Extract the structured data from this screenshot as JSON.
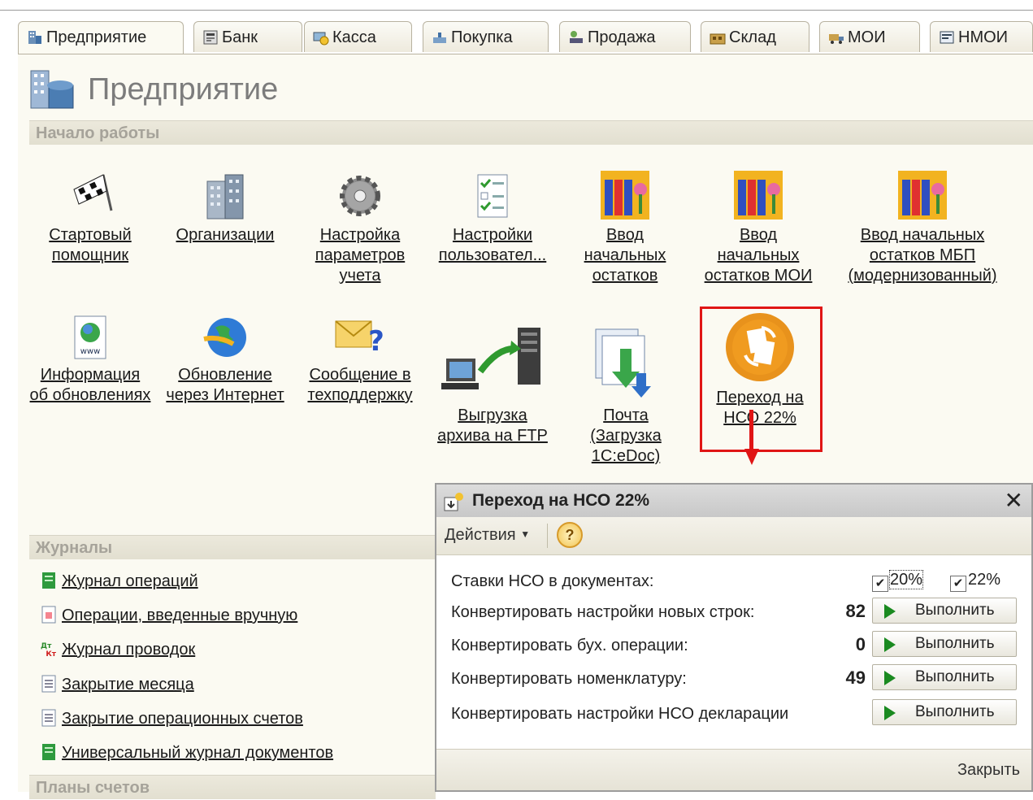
{
  "tabs": [
    {
      "label": "Предприятие",
      "icon": "enterprise-icon",
      "active": true
    },
    {
      "label": "Банк",
      "icon": "bank-icon"
    },
    {
      "label": "Касса",
      "icon": "cash-icon"
    },
    {
      "label": "Покупка",
      "icon": "purchase-icon"
    },
    {
      "label": "Продажа",
      "icon": "sale-icon"
    },
    {
      "label": "Склад",
      "icon": "warehouse-icon"
    },
    {
      "label": "МОИ",
      "icon": "truck-icon"
    },
    {
      "label": "НМОИ",
      "icon": "nmoi-icon"
    }
  ],
  "page": {
    "title": "Предприятие"
  },
  "sections": {
    "start": "Начало работы",
    "journals": "Журналы",
    "charts": "Планы счетов"
  },
  "tiles": [
    {
      "label": "Стартовый помощник",
      "icon": "checkered-flag-icon"
    },
    {
      "label": "Организации",
      "icon": "building-icon"
    },
    {
      "label": "Настройка параметров учета",
      "icon": "gear-icon"
    },
    {
      "label": "Настройки пользовател...",
      "icon": "checklist-icon"
    },
    {
      "label": "Ввод начальных остатков",
      "icon": "binders-icon"
    },
    {
      "label": "Ввод начальных остатков МОИ",
      "icon": "binders-icon"
    },
    {
      "label": "Ввод начальных остатков МБП (модернизованный)",
      "icon": "binders-icon"
    },
    {
      "label": "Информация об обновлениях",
      "icon": "www-document-icon"
    },
    {
      "label": "Обновление через Интернет",
      "icon": "globe-icon"
    },
    {
      "label": "Сообщение в техподдержку",
      "icon": "envelope-question-icon"
    },
    {
      "label": "Выгрузка архива на FTP",
      "icon": "ftp-upload-icon"
    },
    {
      "label": "Почта (Загрузка 1С:eDoc)",
      "icon": "mail-download-icon"
    },
    {
      "label": "Переход на НСО 22%",
      "icon": "nso-transition-icon"
    }
  ],
  "journals": [
    {
      "label": "Журнал операций",
      "icon": "journal-green-icon"
    },
    {
      "label": "Операции, введенные вручную",
      "icon": "manual-op-icon"
    },
    {
      "label": "Журнал проводок ",
      "icon": "dt-kt-icon"
    },
    {
      "label": "Закрытие месяца",
      "icon": "document-icon"
    },
    {
      "label": "Закрытие операционных счетов",
      "icon": "document-icon"
    },
    {
      "label": "Универсальный журнал документов",
      "icon": "journal-green-icon"
    }
  ],
  "dialog": {
    "title": "Переход на НСО 22%",
    "actions_label": "Действия",
    "help": "?",
    "rates_label": "Ставки НСО в документах:",
    "rate20": "20%",
    "rate22": "22%",
    "rate20_checked": true,
    "rate22_checked": true,
    "rows": [
      {
        "label": "Конвертировать настройки новых строк:",
        "count": "82",
        "button": "Выполнить"
      },
      {
        "label": "Конвертировать бух. операции:",
        "count": "0",
        "button": "Выполнить"
      },
      {
        "label": "Конвертировать номенклатуру:",
        "count": "49",
        "button": "Выполнить"
      },
      {
        "label": "Конвертировать настройки НСО декларации",
        "count": "",
        "button": "Выполнить"
      }
    ],
    "close_label": "Закрыть"
  },
  "colors": {
    "highlight": "#e01515",
    "accent_orange": "#e8921c",
    "panel_bg": "#fbfaf2"
  }
}
